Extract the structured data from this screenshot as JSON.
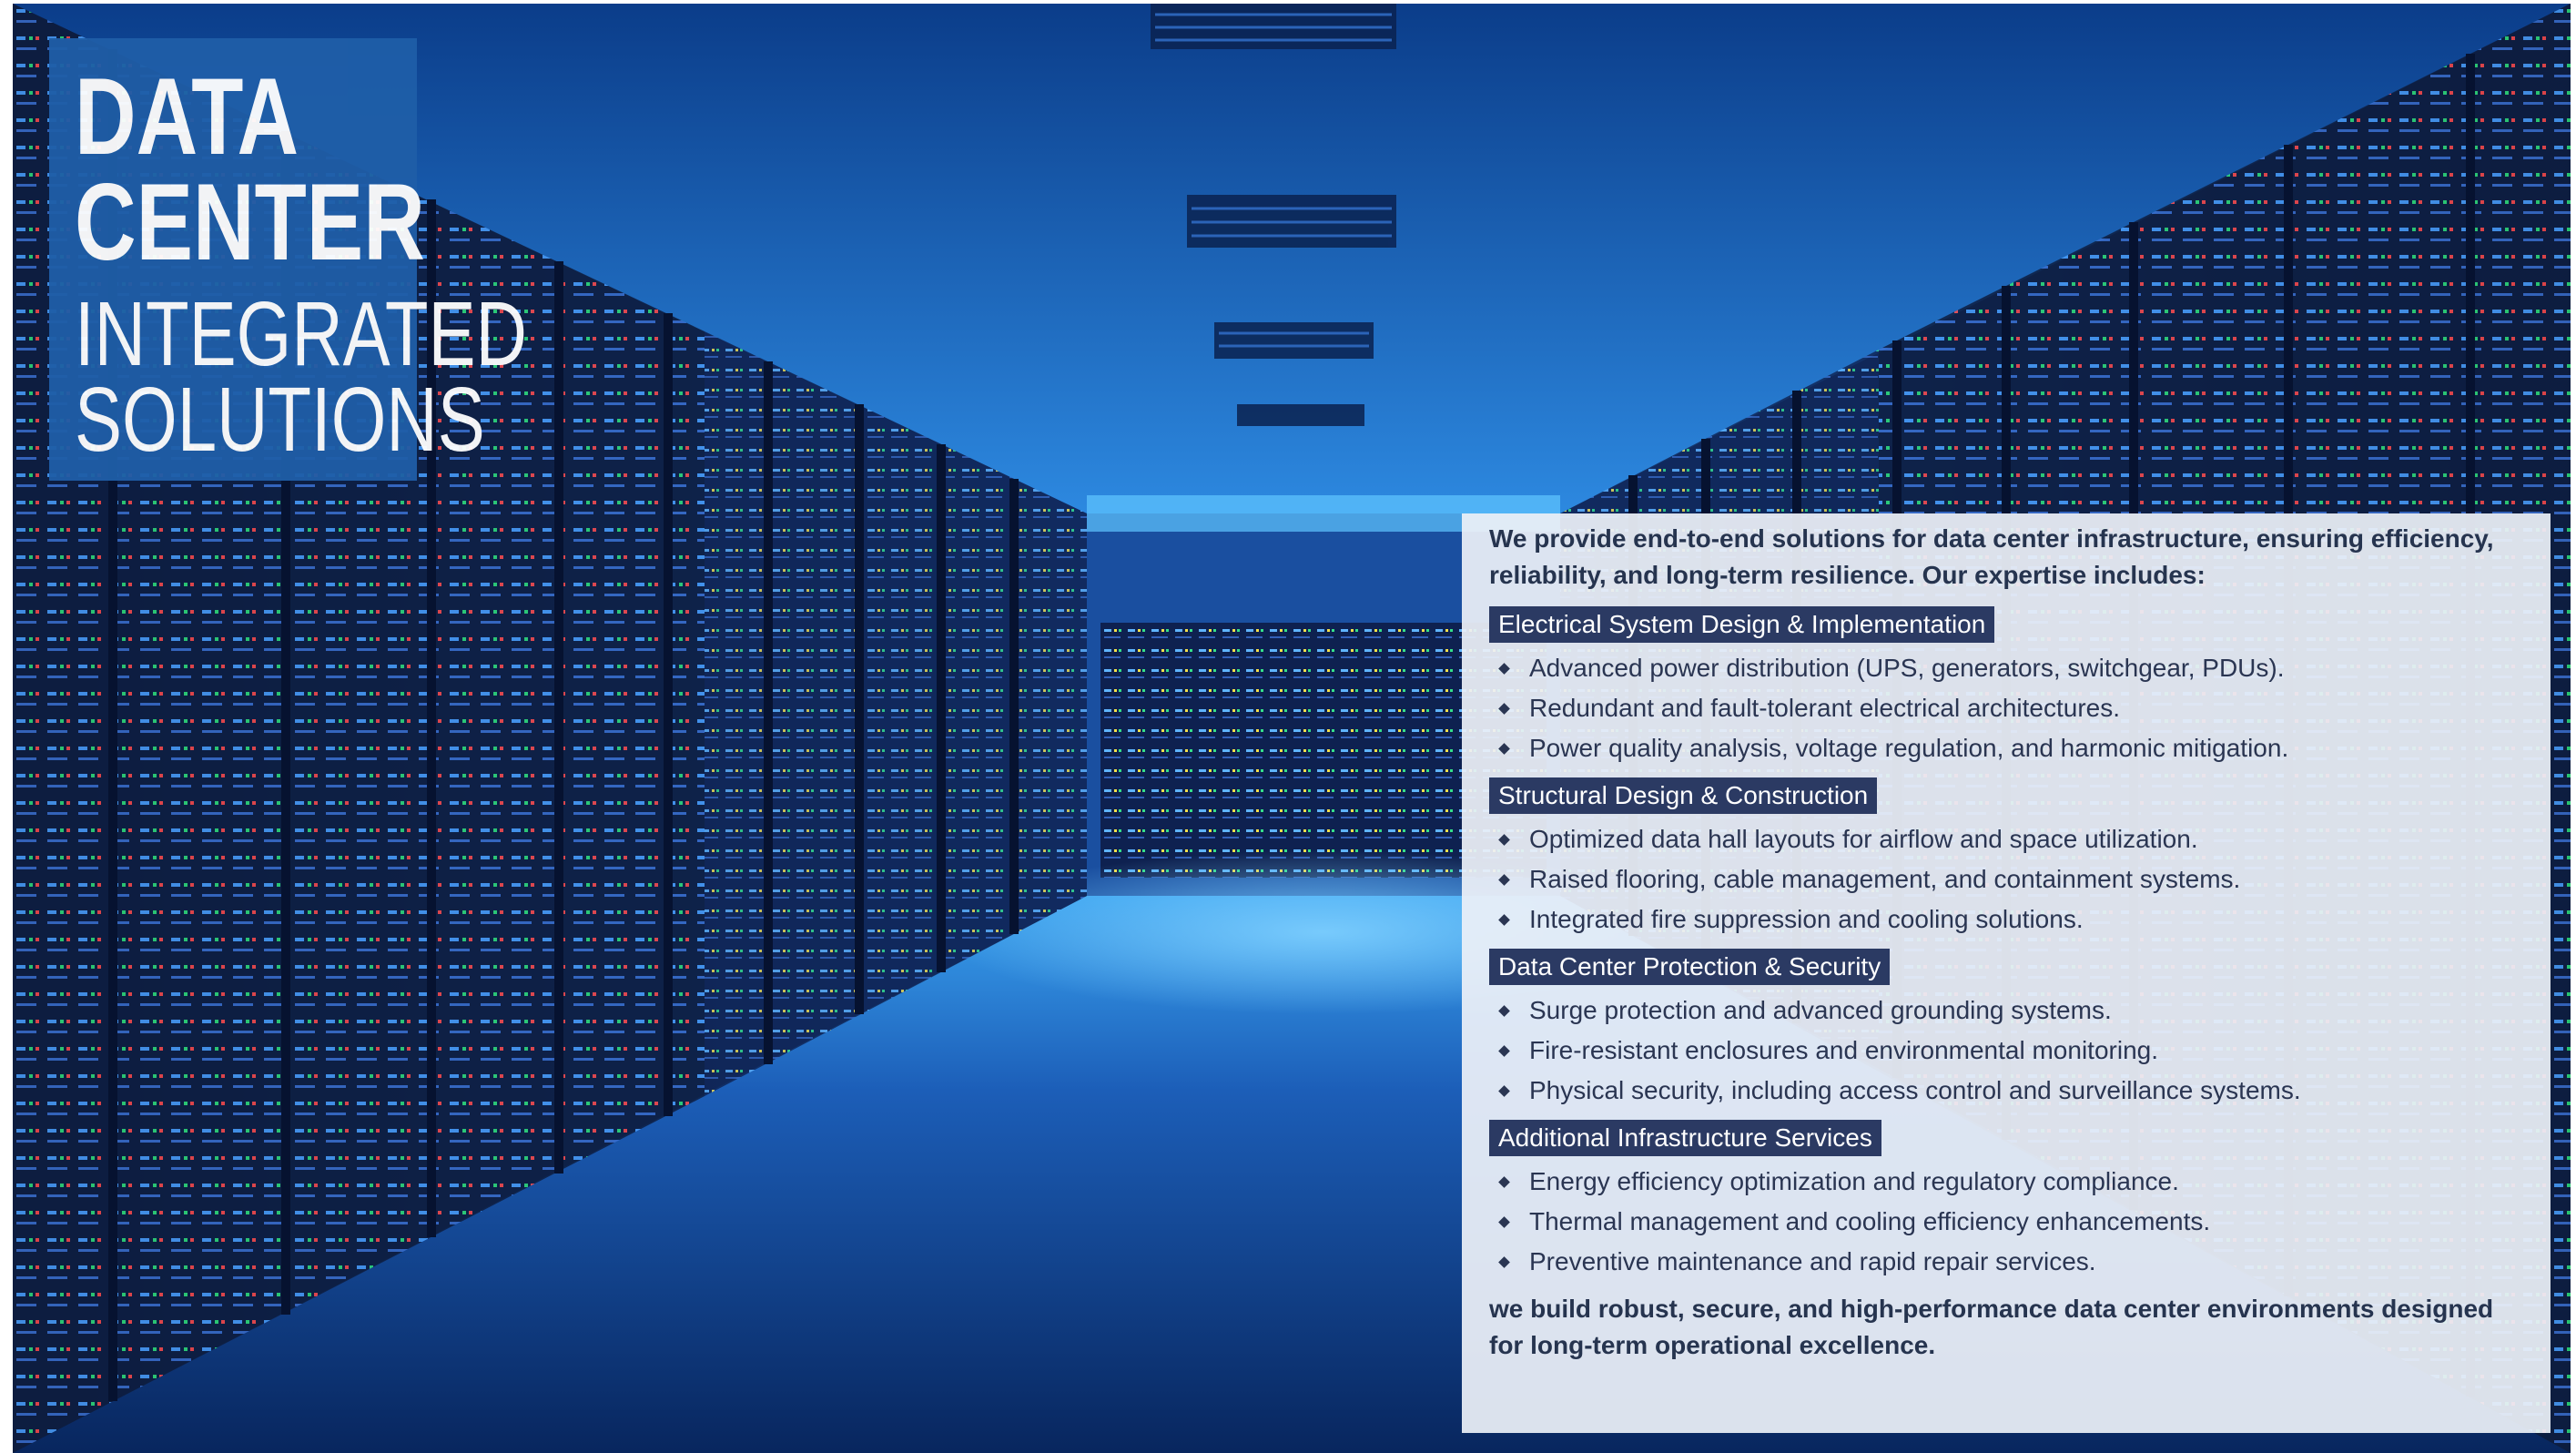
{
  "title": {
    "line1": "DATA",
    "line2": "CENTER",
    "line3": "INTEGRATED",
    "line4": "SOLUTIONS"
  },
  "panel": {
    "intro": "We provide end-to-end solutions for data center infrastructure, ensuring efficiency, reliability, and long-term resilience. Our expertise includes:",
    "sections": [
      {
        "heading": "Electrical System Design & Implementation",
        "items": [
          "Advanced power distribution (UPS, generators, switchgear, PDUs).",
          "Redundant and fault-tolerant electrical architectures.",
          "Power quality analysis, voltage regulation, and harmonic mitigation."
        ]
      },
      {
        "heading": "Structural Design & Construction",
        "items": [
          "Optimized data hall layouts for airflow and space utilization.",
          "Raised flooring, cable management, and containment systems.",
          "Integrated fire suppression and cooling solutions."
        ]
      },
      {
        "heading": "Data Center Protection & Security",
        "items": [
          "Surge protection and advanced grounding systems.",
          "Fire-resistant enclosures and environmental monitoring.",
          "Physical security, including access control and surveillance systems."
        ]
      },
      {
        "heading": "Additional Infrastructure Services",
        "items": [
          "Energy efficiency optimization and regulatory compliance.",
          "Thermal management and cooling efficiency enhancements.",
          "Preventive maintenance and rapid repair services."
        ]
      }
    ],
    "closing": "we build robust, secure, and high-performance data center environments designed for long-term operational excellence."
  },
  "colors": {
    "title_block": "#1f5ea8",
    "section_heading_bg": "#2b3a63",
    "panel_bg": "#ecf0f8",
    "text": "#26344f"
  }
}
